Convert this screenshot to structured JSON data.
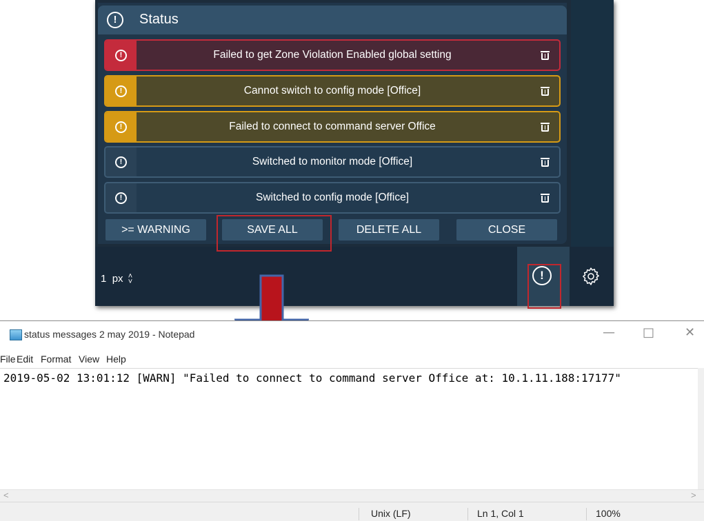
{
  "status_panel": {
    "title": "Status",
    "messages": [
      {
        "severity": "error",
        "text": "Failed to get Zone Violation Enabled global setting"
      },
      {
        "severity": "warning",
        "text": "Cannot switch to config mode [Office]"
      },
      {
        "severity": "warning",
        "text": "Failed to connect to command server Office"
      },
      {
        "severity": "info",
        "text": "Switched to monitor mode [Office]"
      },
      {
        "severity": "info",
        "text": "Switched to config mode [Office]"
      }
    ],
    "buttons": {
      "filter": ">= WARNING",
      "save_all": "SAVE ALL",
      "delete_all": "DELETE ALL",
      "close": "CLOSE"
    },
    "colors": {
      "error": "#c42b3c",
      "warning": "#d69a15",
      "info": "#3e5c75",
      "highlight": "#c1272d"
    }
  },
  "bottom_bar": {
    "size_value": "1",
    "size_unit": "px"
  },
  "icons": [
    "alert-circle-icon",
    "trash-icon",
    "gear-icon",
    "down-arrow-icon",
    "notepad-icon"
  ],
  "notepad": {
    "title": "status messages 2 may 2019 - Notepad",
    "menu": [
      "File",
      "Edit",
      "Format",
      "View",
      "Help"
    ],
    "content": "2019-05-02 13:01:12 [WARN] \"Failed to connect to command server Office at: 10.1.11.188:17177\"",
    "status": {
      "line_ending": "Unix (LF)",
      "position": "Ln 1, Col 1",
      "zoom": "100%"
    }
  }
}
